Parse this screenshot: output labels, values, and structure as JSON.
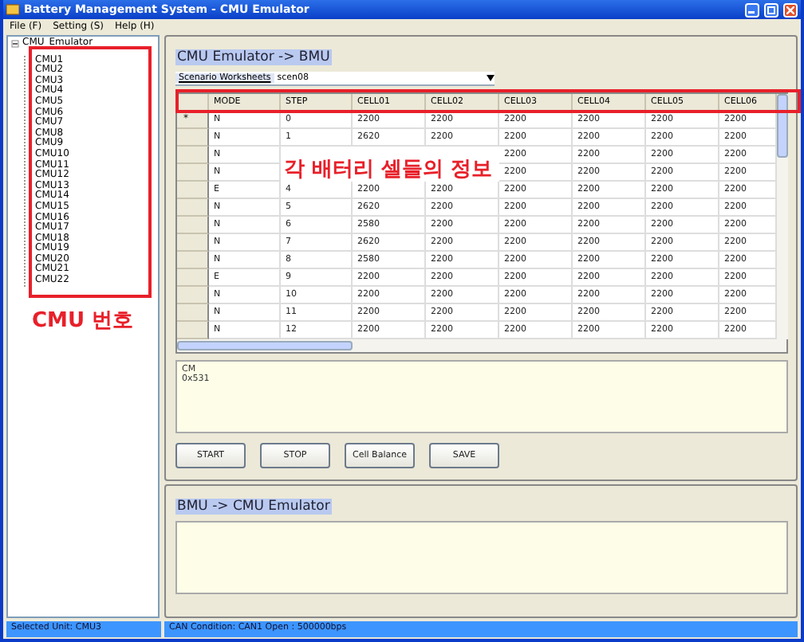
{
  "window": {
    "title": "Battery Management System - CMU Emulator"
  },
  "menu": [
    "File (F)",
    "Setting (S)",
    "Help (H)"
  ],
  "tree": {
    "label": "CMU_Emulator",
    "expanded": true,
    "children": [
      {
        "label": "CMU1"
      },
      {
        "label": "CMU2"
      },
      {
        "label": "CMU3"
      },
      {
        "label": "CMU4"
      },
      {
        "label": "CMU5"
      },
      {
        "label": "CMU6"
      },
      {
        "label": "CMU7"
      },
      {
        "label": "CMU8"
      },
      {
        "label": "CMU9"
      },
      {
        "label": "CMU10"
      },
      {
        "label": "CMU11"
      },
      {
        "label": "CMU12"
      },
      {
        "label": "CMU13"
      },
      {
        "label": "CMU14"
      },
      {
        "label": "CMU15"
      },
      {
        "label": "CMU16"
      },
      {
        "label": "CMU17"
      },
      {
        "label": "CMU18"
      },
      {
        "label": "CMU19"
      },
      {
        "label": "CMU20"
      },
      {
        "label": "CMU21"
      },
      {
        "label": "CMU22"
      }
    ]
  },
  "send_group": {
    "title": "CMU Emulator -> BMU",
    "worksheet_label": "Scenario Worksheets",
    "worksheet_value": "scen08",
    "table": {
      "columns": [
        "MODE",
        "STEP",
        "CELL01",
        "CELL02",
        "CELL03",
        "CELL04",
        "CELL05",
        "CELL06"
      ],
      "rows": [
        {
          "marker": "*",
          "cells": [
            "N",
            "0",
            "2200",
            "2200",
            "2200",
            "2200",
            "2200",
            "2200"
          ]
        },
        {
          "cells": [
            "N",
            "1",
            "2620",
            "2200",
            "2200",
            "2200",
            "2200",
            "2200"
          ]
        },
        {
          "cells": [
            "N",
            null,
            null,
            null,
            "2200",
            "2200",
            "2200",
            "2200"
          ]
        },
        {
          "cells": [
            "N",
            null,
            null,
            null,
            "2200",
            "2200",
            "2200",
            "2200"
          ]
        },
        {
          "cells": [
            "E",
            "4",
            "2200",
            "2200",
            "2200",
            "2200",
            "2200",
            "2200"
          ]
        },
        {
          "cells": [
            "N",
            "5",
            "2620",
            "2200",
            "2200",
            "2200",
            "2200",
            "2200"
          ]
        },
        {
          "cells": [
            "N",
            "6",
            "2580",
            "2200",
            "2200",
            "2200",
            "2200",
            "2200"
          ]
        },
        {
          "cells": [
            "N",
            "7",
            "2620",
            "2200",
            "2200",
            "2200",
            "2200",
            "2200"
          ]
        },
        {
          "cells": [
            "N",
            "8",
            "2580",
            "2200",
            "2200",
            "2200",
            "2200",
            "2200"
          ]
        },
        {
          "cells": [
            "E",
            "9",
            "2200",
            "2200",
            "2200",
            "2200",
            "2200",
            "2200"
          ]
        },
        {
          "cells": [
            "N",
            "10",
            "2200",
            "2200",
            "2200",
            "2200",
            "2200",
            "2200"
          ]
        },
        {
          "cells": [
            "N",
            "11",
            "2200",
            "2200",
            "2200",
            "2200",
            "2200",
            "2200"
          ]
        },
        {
          "cells": [
            "N",
            "12",
            "2200",
            "2200",
            "2200",
            "2200",
            "2200",
            "2200"
          ]
        }
      ]
    },
    "log": [
      "CM",
      "0x531"
    ],
    "buttons": [
      "START",
      "STOP",
      "Cell Balance",
      "SAVE"
    ]
  },
  "receive_group": {
    "title": "BMU -> CMU Emulator"
  },
  "status_bar": [
    "Selected Unit: CMU3",
    "CAN Condition: CAN1 Open : 500000bps"
  ],
  "annotations": [
    {
      "kind": "box-label",
      "text": "CMU 번호"
    },
    {
      "kind": "overlay",
      "text": "각 배터리 셀들의 정보"
    }
  ]
}
